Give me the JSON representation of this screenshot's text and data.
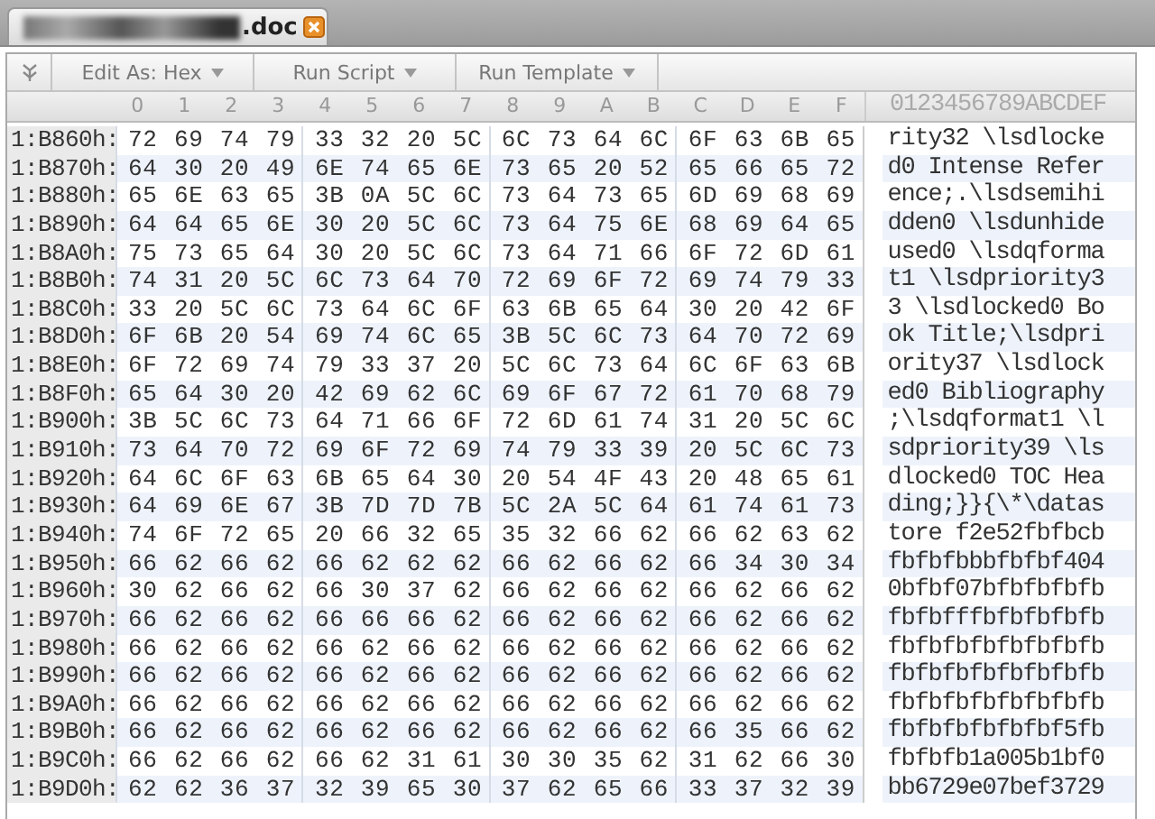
{
  "tab": {
    "title": ".doc"
  },
  "toolbar": [
    {
      "label": "Edit As: Hex"
    },
    {
      "label": "Run Script"
    },
    {
      "label": "Run Template"
    }
  ],
  "columns": [
    "0",
    "1",
    "2",
    "3",
    "4",
    "5",
    "6",
    "7",
    "8",
    "9",
    "A",
    "B",
    "C",
    "D",
    "E",
    "F"
  ],
  "text_header": "0123456789ABCDEF",
  "rows": [
    {
      "address": "1:B860h:",
      "bytes": [
        "72 69 74 79",
        "33 32 20 5C",
        "6C 73 64 6C",
        "6F 63 6B 65"
      ],
      "text": "rity32 \\lsdlocke"
    },
    {
      "address": "1:B870h:",
      "bytes": [
        "64 30 20 49",
        "6E 74 65 6E",
        "73 65 20 52",
        "65 66 65 72"
      ],
      "text": "d0 Intense Refer"
    },
    {
      "address": "1:B880h:",
      "bytes": [
        "65 6E 63 65",
        "3B 0A 5C 6C",
        "73 64 73 65",
        "6D 69 68 69"
      ],
      "text": "ence;.\\lsdsemihi"
    },
    {
      "address": "1:B890h:",
      "bytes": [
        "64 64 65 6E",
        "30 20 5C 6C",
        "73 64 75 6E",
        "68 69 64 65"
      ],
      "text": "dden0 \\lsdunhide"
    },
    {
      "address": "1:B8A0h:",
      "bytes": [
        "75 73 65 64",
        "30 20 5C 6C",
        "73 64 71 66",
        "6F 72 6D 61"
      ],
      "text": "used0 \\lsdqforma"
    },
    {
      "address": "1:B8B0h:",
      "bytes": [
        "74 31 20 5C",
        "6C 73 64 70",
        "72 69 6F 72",
        "69 74 79 33"
      ],
      "text": "t1 \\lsdpriority3"
    },
    {
      "address": "1:B8C0h:",
      "bytes": [
        "33 20 5C 6C",
        "73 64 6C 6F",
        "63 6B 65 64",
        "30 20 42 6F"
      ],
      "text": "3 \\lsdlocked0 Bo"
    },
    {
      "address": "1:B8D0h:",
      "bytes": [
        "6F 6B 20 54",
        "69 74 6C 65",
        "3B 5C 6C 73",
        "64 70 72 69"
      ],
      "text": "ok Title;\\lsdpri"
    },
    {
      "address": "1:B8E0h:",
      "bytes": [
        "6F 72 69 74",
        "79 33 37 20",
        "5C 6C 73 64",
        "6C 6F 63 6B"
      ],
      "text": "ority37 \\lsdlock"
    },
    {
      "address": "1:B8F0h:",
      "bytes": [
        "65 64 30 20",
        "42 69 62 6C",
        "69 6F 67 72",
        "61 70 68 79"
      ],
      "text": "ed0 Bibliography"
    },
    {
      "address": "1:B900h:",
      "bytes": [
        "3B 5C 6C 73",
        "64 71 66 6F",
        "72 6D 61 74",
        "31 20 5C 6C"
      ],
      "text": ";\\lsdqformat1 \\l"
    },
    {
      "address": "1:B910h:",
      "bytes": [
        "73 64 70 72",
        "69 6F 72 69",
        "74 79 33 39",
        "20 5C 6C 73"
      ],
      "text": "sdpriority39 \\ls"
    },
    {
      "address": "1:B920h:",
      "bytes": [
        "64 6C 6F 63",
        "6B 65 64 30",
        "20 54 4F 43",
        "20 48 65 61"
      ],
      "text": "dlocked0 TOC Hea"
    },
    {
      "address": "1:B930h:",
      "bytes": [
        "64 69 6E 67",
        "3B 7D 7D 7B",
        "5C 2A 5C 64",
        "61 74 61 73"
      ],
      "text": "ding;}}{\\*\\datas"
    },
    {
      "address": "1:B940h:",
      "bytes": [
        "74 6F 72 65",
        "20 66 32 65",
        "35 32 66 62",
        "66 62 63 62"
      ],
      "text": "tore f2e52fbfbcb"
    },
    {
      "address": "1:B950h:",
      "bytes": [
        "66 62 66 62",
        "66 62 62 62",
        "66 62 66 62",
        "66 34 30 34"
      ],
      "text": "fbfbfbbbfbfbf404"
    },
    {
      "address": "1:B960h:",
      "bytes": [
        "30 62 66 62",
        "66 30 37 62",
        "66 62 66 62",
        "66 62 66 62"
      ],
      "text": "0bfbf07bfbfbfbfb"
    },
    {
      "address": "1:B970h:",
      "bytes": [
        "66 62 66 62",
        "66 66 66 62",
        "66 62 66 62",
        "66 62 66 62"
      ],
      "text": "fbfbfffbfbfbfbfb"
    },
    {
      "address": "1:B980h:",
      "bytes": [
        "66 62 66 62",
        "66 62 66 62",
        "66 62 66 62",
        "66 62 66 62"
      ],
      "text": "fbfbfbfbfbfbfbfb"
    },
    {
      "address": "1:B990h:",
      "bytes": [
        "66 62 66 62",
        "66 62 66 62",
        "66 62 66 62",
        "66 62 66 62"
      ],
      "text": "fbfbfbfbfbfbfbfb"
    },
    {
      "address": "1:B9A0h:",
      "bytes": [
        "66 62 66 62",
        "66 62 66 62",
        "66 62 66 62",
        "66 62 66 62"
      ],
      "text": "fbfbfbfbfbfbfbfb"
    },
    {
      "address": "1:B9B0h:",
      "bytes": [
        "66 62 66 62",
        "66 62 66 62",
        "66 62 66 62",
        "66 35 66 62"
      ],
      "text": "fbfbfbfbfbfbf5fb"
    },
    {
      "address": "1:B9C0h:",
      "bytes": [
        "66 62 66 62",
        "66 62 31 61",
        "30 30 35 62",
        "31 62 66 30"
      ],
      "text": "fbfbfb1a005b1bf0"
    },
    {
      "address": "1:B9D0h:",
      "bytes": [
        "62 62 36 37",
        "32 39 65 30",
        "37 62 65 66",
        "33 37 32 39"
      ],
      "text": "bb6729e07bef3729"
    }
  ]
}
